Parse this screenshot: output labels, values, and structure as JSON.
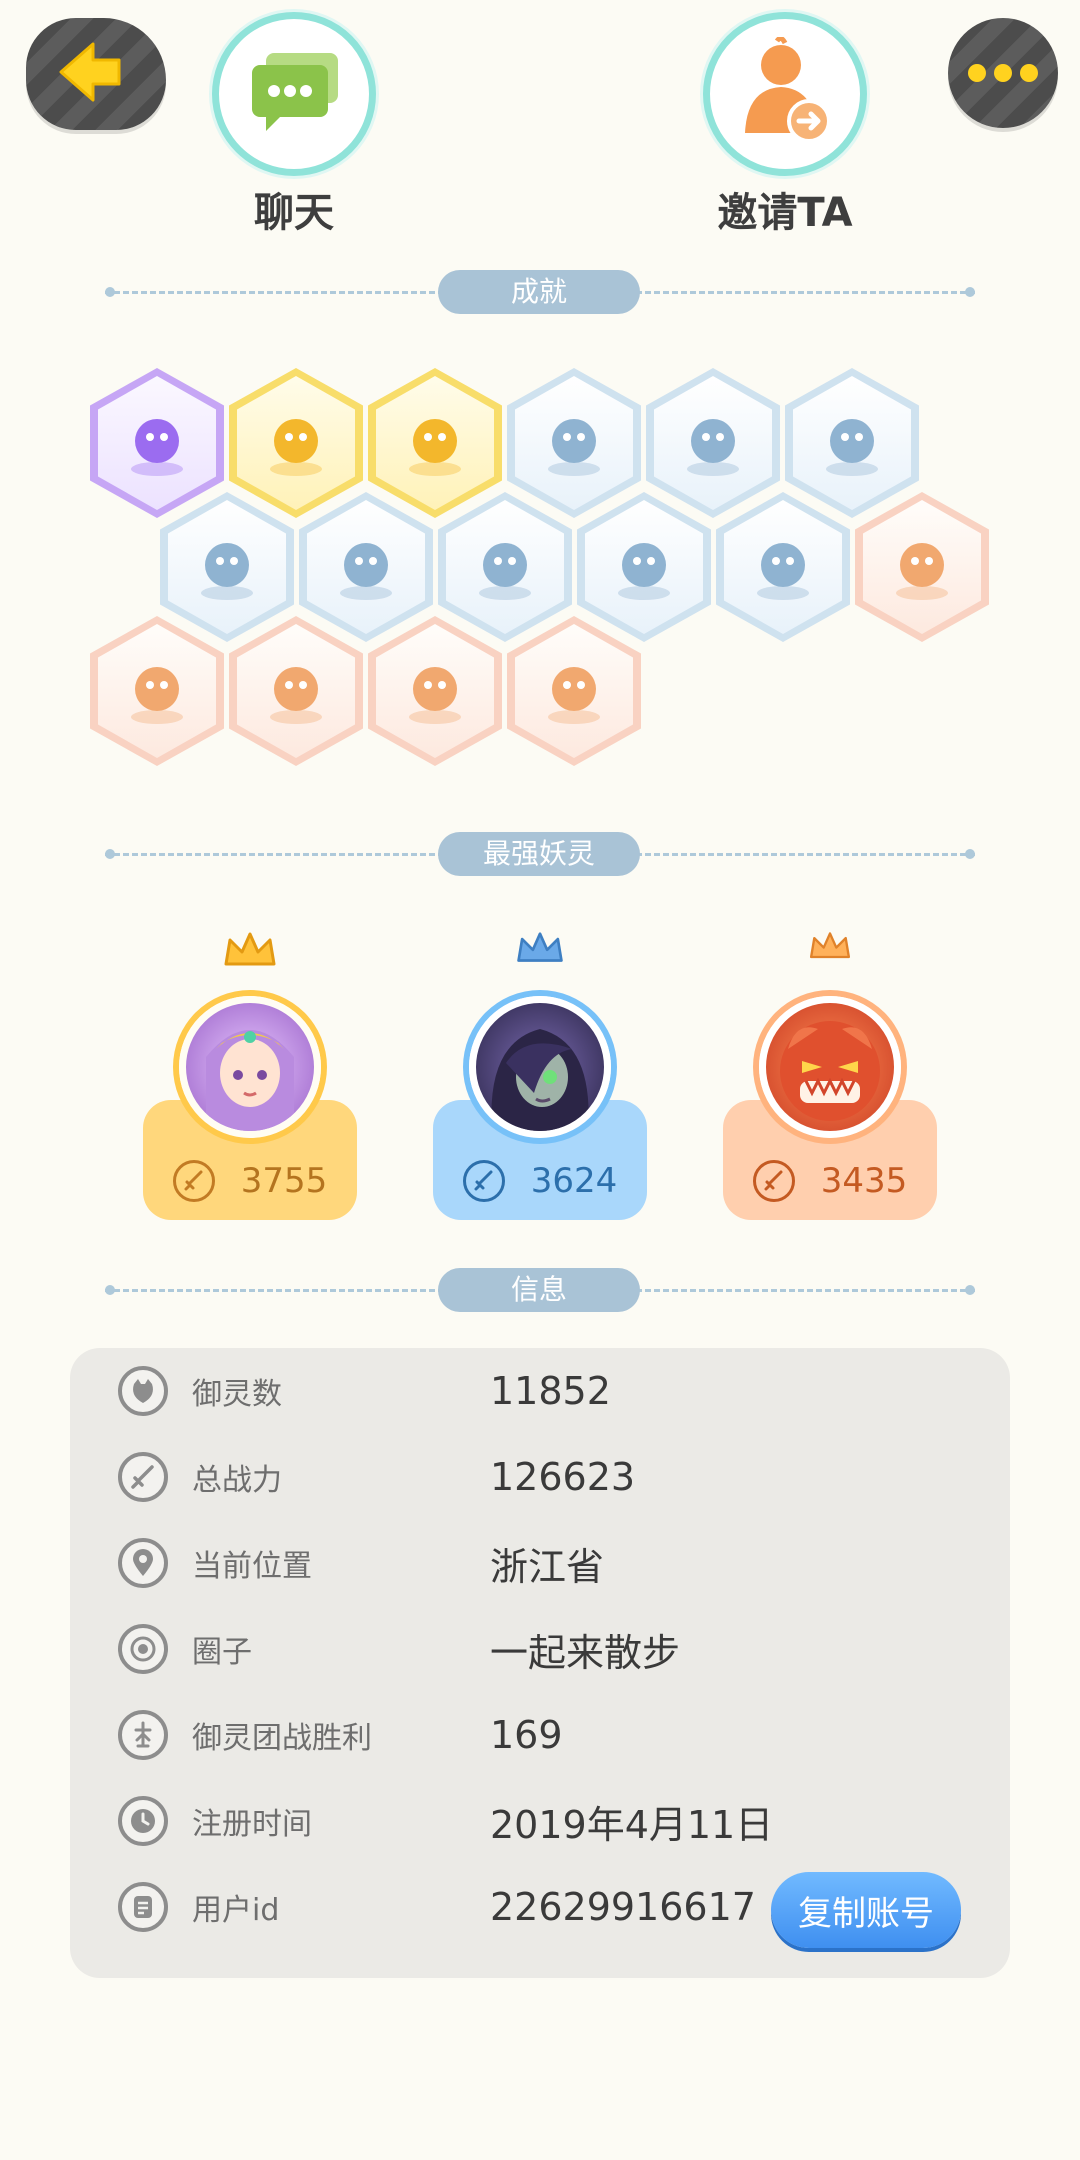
{
  "header": {
    "back_icon": "arrow-left-icon",
    "more_icon": "ellipsis-icon",
    "chat": {
      "label": "聊天",
      "icon": "chat-bubble-icon"
    },
    "invite": {
      "label": "邀请TA",
      "icon": "person-invite-icon"
    }
  },
  "sections": {
    "achievements": "成就",
    "strongest": "最强妖灵",
    "info": "信息"
  },
  "achievements": [
    {
      "icon": "purple-cat-badge-icon",
      "tier": "purple"
    },
    {
      "icon": "golden-ball-icon",
      "tier": "gold"
    },
    {
      "icon": "golden-taiji-icon",
      "tier": "gold"
    },
    {
      "icon": "portal-ring-icon",
      "tier": "blue"
    },
    {
      "icon": "crescent-moon-icon",
      "tier": "blue"
    },
    {
      "icon": "spirit-statue-icon",
      "tier": "blue"
    },
    {
      "icon": "cat-stroller-icon",
      "tier": "blue"
    },
    {
      "icon": "taiji-flag-icon",
      "tier": "blue"
    },
    {
      "icon": "koi-fish-icon",
      "tier": "blue"
    },
    {
      "icon": "shield-emblem-icon",
      "tier": "blue"
    },
    {
      "icon": "winged-dragon-icon",
      "tier": "blue"
    },
    {
      "icon": "sneaker-icon",
      "tier": "peach"
    },
    {
      "icon": "hooded-egg-icon",
      "tier": "peach"
    },
    {
      "icon": "fox-spirit-icon",
      "tier": "peach"
    },
    {
      "icon": "two-foxes-icon",
      "tier": "peach"
    },
    {
      "icon": "fox-book-icon",
      "tier": "peach"
    }
  ],
  "spirits": [
    {
      "power": "3755",
      "tier": "gold",
      "crown": "gold-crown-icon"
    },
    {
      "power": "3624",
      "tier": "blue",
      "crown": "blue-crown-icon"
    },
    {
      "power": "3435",
      "tier": "orange",
      "crown": "orange-crown-icon"
    }
  ],
  "info": {
    "rows": [
      {
        "key": "御灵数",
        "value": "11852",
        "icon": "spirit-count-icon"
      },
      {
        "key": "总战力",
        "value": "126623",
        "icon": "sword-icon"
      },
      {
        "key": "当前位置",
        "value": "浙江省",
        "icon": "location-pin-icon"
      },
      {
        "key": "圈子",
        "value": "一起来散步",
        "icon": "circle-target-icon"
      },
      {
        "key": "御灵团战胜利",
        "value": "169",
        "icon": "trophy-icon"
      },
      {
        "key": "注册时间",
        "value": "2019年4月11日",
        "icon": "clock-icon"
      },
      {
        "key": "用户id",
        "value": "22629916617",
        "icon": "id-card-icon"
      }
    ],
    "copy_button": "复制账号"
  },
  "colors": {
    "background": "#fcfbf4",
    "panel": "#ebeae6",
    "accent_blue": "#3f8ff0",
    "chat_green": "#8bc34a",
    "invite_orange": "#f59b50"
  }
}
